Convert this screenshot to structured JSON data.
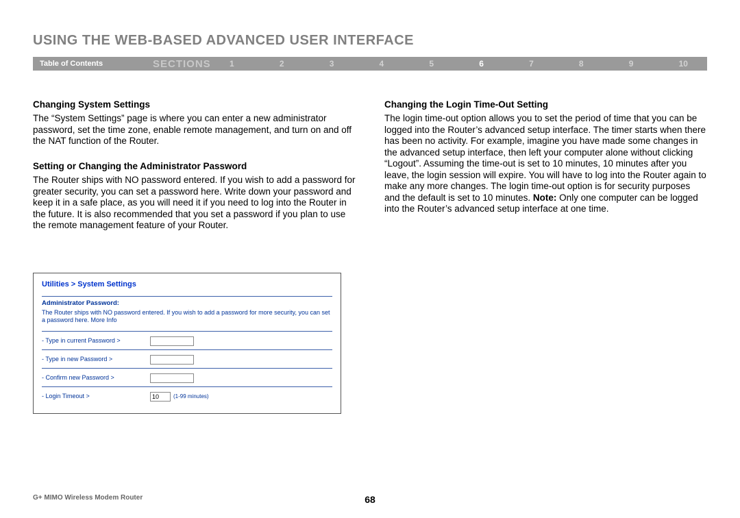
{
  "header": {
    "title": "USING THE WEB-BASED ADVANCED USER INTERFACE",
    "toc": "Table of Contents",
    "sections_label": "SECTIONS",
    "sections": [
      "1",
      "2",
      "3",
      "4",
      "5",
      "6",
      "7",
      "8",
      "9",
      "10"
    ],
    "active_section": "6"
  },
  "left": {
    "h1": "Changing System Settings",
    "p1": "The “System Settings” page is where you can enter a new administrator password, set the time zone, enable remote management, and turn on and off the NAT function of the Router.",
    "h2": "Setting or Changing the Administrator Password",
    "p2": "The Router ships with NO password entered. If you wish to add a password for greater security, you can set a password here. Write down your password and keep it in a safe place, as you will need it if you need to log into the Router in the future. It is also recommended that you set a password if you plan to use the remote management feature of your Router."
  },
  "right": {
    "h1": "Changing the Login Time-Out Setting",
    "p1a": "The login time-out option allows you to set the period of time that you can be logged into the Router’s advanced setup interface. The timer starts when there has been no activity. For example, imagine you have made some changes in the advanced setup interface, then left your computer alone without clicking “Logout”. Assuming the time-out is set to 10 minutes, 10 minutes after you leave, the login session will expire. You will have to log into the Router again to make any more changes. The login time-out option is for security purposes and the default is set to 10 minutes. ",
    "note_label": "Note:",
    "p1b": " Only one computer can be logged into the Router’s advanced setup interface at one time."
  },
  "panel": {
    "breadcrumb": "Utilities > System Settings",
    "section": "Administrator Password:",
    "desc": "The Router ships with NO password entered. If you wish to add a password for more security, you can set a password here. ",
    "more": "More Info",
    "rows": {
      "current": "- Type in current Password >",
      "new": "- Type in new Password >",
      "confirm": "- Confirm new Password >",
      "timeout": "- Login Timeout >"
    },
    "timeout_value": "10",
    "timeout_hint": "(1-99 minutes)"
  },
  "footer": {
    "product": "G+ MIMO Wireless Modem Router",
    "page": "68"
  }
}
